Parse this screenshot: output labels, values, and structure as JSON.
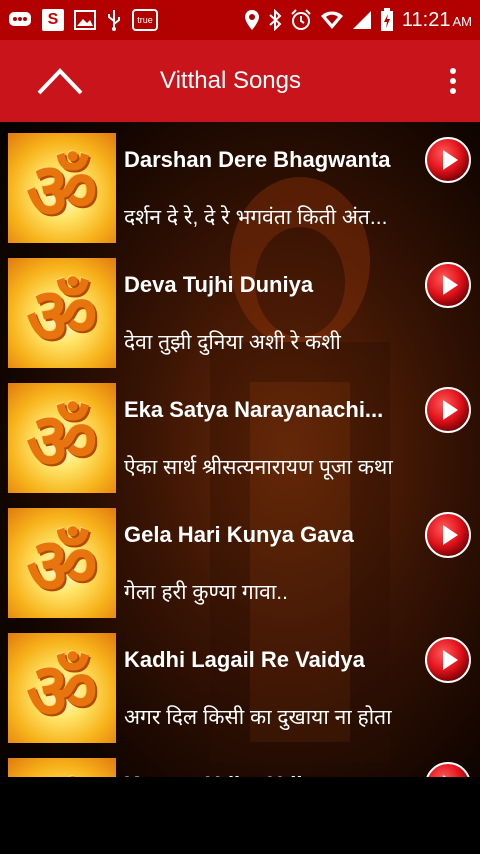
{
  "status_bar": {
    "icons": [
      "messages-icon",
      "s-app-icon",
      "gallery-icon",
      "usb-icon",
      "true-app-icon",
      "location-icon",
      "bluetooth-icon",
      "alarm-icon",
      "wifi-icon",
      "signal-icon",
      "battery-charging-icon"
    ],
    "s_label": "S",
    "true_label": "true",
    "time": "11:21",
    "ampm": "AM"
  },
  "app_bar": {
    "title": "Vitthal Songs",
    "up_icon": "chevron-up-icon",
    "menu_icon": "more-vert-icon",
    "color": "#c8141a"
  },
  "songs": [
    {
      "title": "Darshan Dere Bhagwanta",
      "subtitle": "दर्शन दे रे, दे रे भगवंता किती अंत..."
    },
    {
      "title": "Deva Tujhi Duniya",
      "subtitle": "देवा तुझी दुनिया अशी रे कशी"
    },
    {
      "title": "Eka Satya Narayanachi...",
      "subtitle": "ऐका सार्थ श्रीसत्यनारायण पूजा कथा"
    },
    {
      "title": "Gela Hari Kunya Gava",
      "subtitle": "गेला हरी कुण्या गावा.."
    },
    {
      "title": "Kadhi Lagail Re Vaidya",
      "subtitle": "अगर दिल किसी का दुखाया ना होता"
    },
    {
      "title": "Karuva Udho Udho",
      "subtitle": ""
    }
  ],
  "colors": {
    "status_bar": "#b30000",
    "play_button": "#e0121a",
    "text": "#ffffff"
  }
}
